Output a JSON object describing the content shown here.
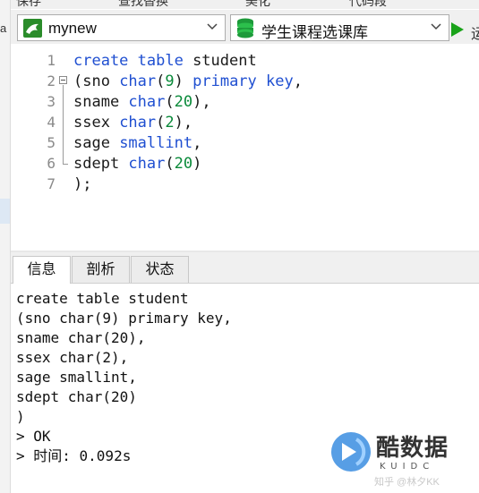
{
  "left_panel": {
    "fragment": "a"
  },
  "top_toolbar": {
    "items": [
      "保存",
      "查找替换",
      "美化",
      "代码段"
    ]
  },
  "connection": {
    "name": "mynew"
  },
  "database": {
    "name": "学生课程选课库"
  },
  "run": {
    "label": "运"
  },
  "editor": {
    "line_numbers": [
      "1",
      "2",
      "3",
      "4",
      "5",
      "6",
      "7"
    ],
    "lines": [
      [
        "create table",
        " student"
      ],
      [
        "(sno ",
        "char",
        "(",
        "9",
        ") ",
        "primary key",
        ","
      ],
      [
        "sname ",
        "char",
        "(",
        "20",
        "),"
      ],
      [
        "ssex ",
        "char",
        "(",
        "2",
        "),"
      ],
      [
        "sage ",
        "smallint",
        ","
      ],
      [
        "sdept ",
        "char",
        "(",
        "20",
        ")"
      ],
      [
        ");"
      ]
    ]
  },
  "tabs": [
    {
      "label": "信息",
      "active": true
    },
    {
      "label": "剖析",
      "active": false
    },
    {
      "label": "状态",
      "active": false
    }
  ],
  "output": {
    "lines": [
      "create table student",
      "(sno char(9) primary key,",
      "sname char(20),",
      "ssex char(2),",
      "sage smallint,",
      "sdept char(20)",
      ")",
      "> OK",
      "> 时间: 0.092s"
    ]
  },
  "watermark": {
    "brand": "酷数据",
    "sub": "KUIDC",
    "credit": "知乎 @林夕KK"
  },
  "colors": {
    "keyword": "#1f4fd1",
    "number": "#0a8a3a",
    "run_green": "#1aa31a"
  }
}
